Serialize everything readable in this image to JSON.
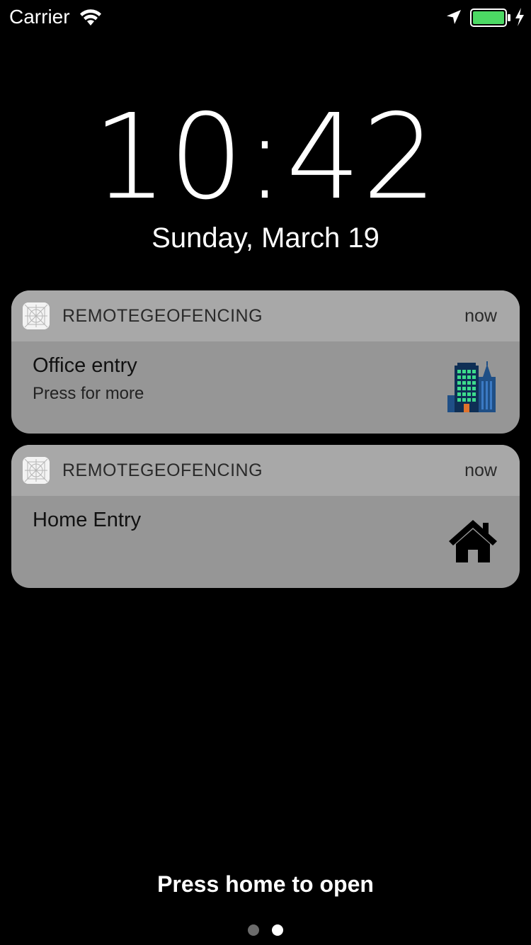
{
  "status_bar": {
    "carrier": "Carrier",
    "icons": [
      "wifi-icon",
      "location-arrow-icon",
      "battery-icon",
      "charging-bolt-icon"
    ],
    "battery_level": 1.0,
    "battery_color": "#4cd964"
  },
  "lock_screen": {
    "time": "10:42",
    "date": "Sunday, March 19"
  },
  "notifications": [
    {
      "app_name": "REMOTEGEOFENCING",
      "time": "now",
      "title": "Office entry",
      "body": "Press for more",
      "attachment_icon": "office-buildings-icon"
    },
    {
      "app_name": "REMOTEGEOFENCING",
      "time": "now",
      "title": "Home Entry",
      "body": "",
      "attachment_icon": "house-icon"
    }
  ],
  "footer": {
    "hint": "Press home to open",
    "page_count": 2,
    "active_page": 2
  }
}
